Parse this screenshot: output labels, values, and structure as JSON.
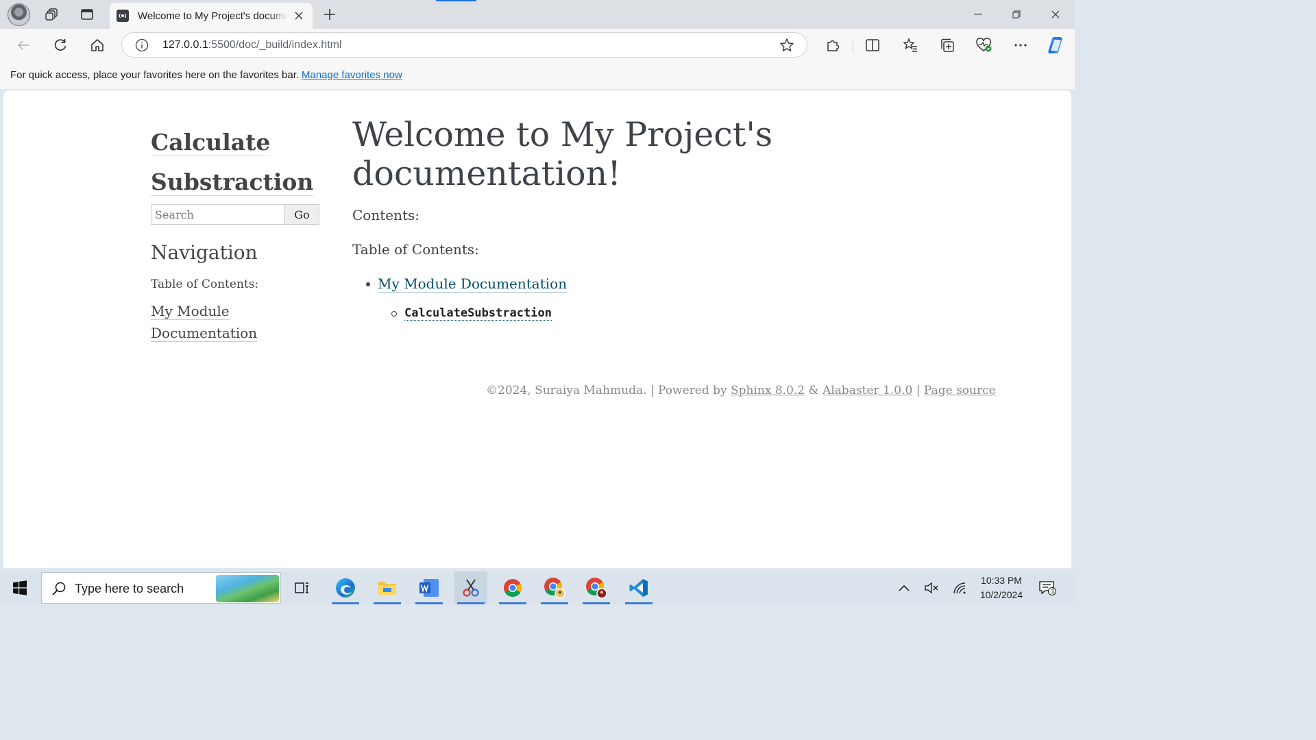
{
  "browser": {
    "tab": {
      "title": "Welcome to My Project's documentation!"
    },
    "address_bar": {
      "url_host": "127.0.0.1",
      "url_rest": ":5500/doc/_build/index.html"
    },
    "favorites_bar": {
      "message": "For quick access, place your favorites here on the favorites bar.",
      "link": "Manage favorites now"
    }
  },
  "sidebar": {
    "logo_text": "Calculate Substraction",
    "search": {
      "placeholder": "Search",
      "button": "Go"
    },
    "nav_heading": "Navigation",
    "toc_caption": "Table of Contents:",
    "toc_link": "My Module Documentation"
  },
  "main": {
    "title": "Welcome to My Project's documentation!",
    "contents_label": "Contents:",
    "toc_caption": "Table of Contents:",
    "toc_items": [
      {
        "label": "My Module Documentation",
        "children": [
          {
            "label": "CalculateSubstraction"
          }
        ]
      }
    ]
  },
  "footer": {
    "copyright": "©2024, Suraiya Mahmuda.",
    "powered_by": "Powered by",
    "sphinx": "Sphinx 8.0.2",
    "amp": "&",
    "alabaster": "Alabaster 1.0.0",
    "page_source": "Page source",
    "sep": "|"
  },
  "taskbar": {
    "search_placeholder": "Type here to search",
    "time": "10:33 PM",
    "date": "10/2/2024",
    "notification_count": "1"
  },
  "colors": {
    "accent": "#1a73e8",
    "link": "#004b6b",
    "favorites_link": "#0f6cbd"
  }
}
